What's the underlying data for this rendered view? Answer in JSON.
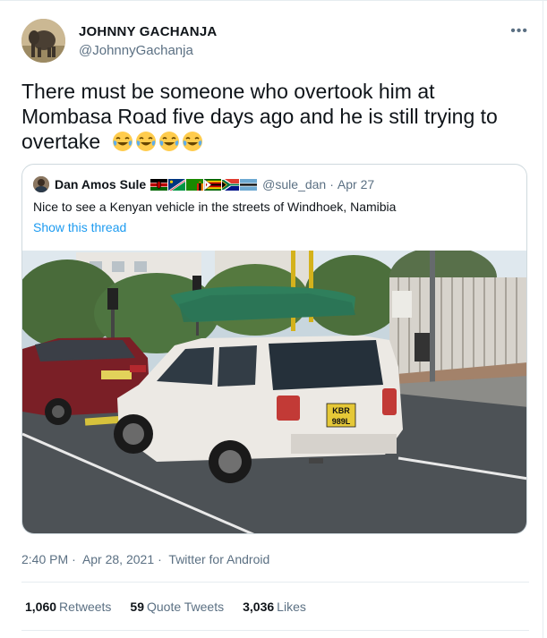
{
  "tweet": {
    "author_name": "JOHNNY GACHANJA",
    "author_handle": "@JohnnyGachanja",
    "text": "There must be someone who overtook him at Mombasa Road five days ago and he is still trying to overtake",
    "emoji": [
      "face-with-tears-of-joy",
      "face-with-tears-of-joy",
      "face-with-tears-of-joy",
      "face-with-tears-of-joy"
    ],
    "time": "2:40 PM",
    "date": "Apr 28, 2021",
    "source": "Twitter for Android",
    "separator": "·"
  },
  "quoted": {
    "author_name": "Dan Amos Sule",
    "flags": [
      "kenya-flag",
      "namibia-flag",
      "zambia-flag",
      "zimbabwe-flag",
      "south-africa-flag",
      "botswana-flag"
    ],
    "handle": "@sule_dan",
    "separator": "·",
    "date": "Apr 27",
    "text": "Nice to see a Kenyan vehicle in the streets of Windhoek, Namibia",
    "show_thread": "Show this thread",
    "plate_line1": "KBR",
    "plate_line2": "989L"
  },
  "stats": {
    "retweets_count": "1,060",
    "retweets_label": "Retweets",
    "quotes_count": "59",
    "quotes_label": "Quote Tweets",
    "likes_count": "3,036",
    "likes_label": "Likes"
  },
  "colors": {
    "text": "#0f1419",
    "secondary": "#5b7083",
    "link": "#1d9bf0",
    "border": "#cfd9de"
  }
}
